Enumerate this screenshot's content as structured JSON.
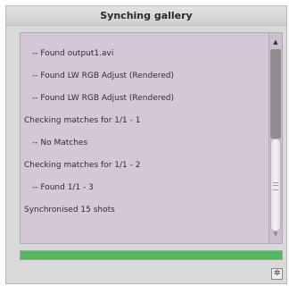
{
  "window": {
    "title": "Synching gallery"
  },
  "log": {
    "lines": [
      "-- Found output1.avi",
      "-- Found LW RGB Adjust (Rendered)",
      "-- Found LW RGB Adjust (Rendered)",
      "Checking matches for  1/1 - 1",
      "-- No Matches",
      "Checking matches for  1/1 - 2",
      "-- Found  1/1 - 3",
      "Synchronised 15 shots"
    ]
  },
  "progress": {
    "value": 1.0,
    "color": "#52b85e"
  },
  "icons": {
    "scroll_up": "▲",
    "scroll_down": "▼",
    "corner": "✲"
  }
}
